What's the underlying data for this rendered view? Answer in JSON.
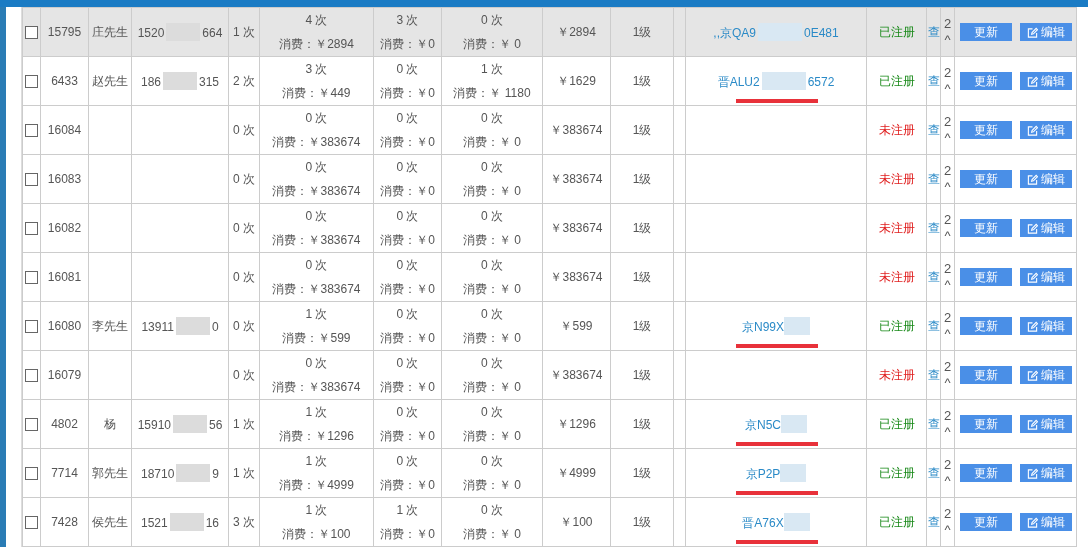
{
  "rows": [
    {
      "highlighted": true,
      "checked": false,
      "id": "15795",
      "name": "庄先生",
      "phone": [
        "1520",
        "664"
      ],
      "visits": "1 次",
      "usage": [
        [
          "4 次",
          "消费：￥2894"
        ],
        [
          "3 次",
          "消费：￥0"
        ],
        [
          "0 次",
          "消费：￥ 0"
        ]
      ],
      "total": "￥2894",
      "level": "1级",
      "plate": [
        ",,京QA9",
        "0E481"
      ],
      "underlined": false,
      "registered": true,
      "status": "已注册",
      "view": "查",
      "column_15": [
        "2",
        "^"
      ],
      "buttons": [
        "更新",
        "编辑"
      ]
    },
    {
      "highlighted": false,
      "checked": false,
      "id": "6433",
      "name": "赵先生",
      "phone": [
        "186",
        "315"
      ],
      "visits": "2 次",
      "usage": [
        [
          "3 次",
          "消费：￥449"
        ],
        [
          "0 次",
          "消费：￥0"
        ],
        [
          "1 次",
          "消费：￥ 1180"
        ]
      ],
      "total": "￥1629",
      "level": "1级",
      "plate": [
        "晋ALU2",
        "6572"
      ],
      "underlined": true,
      "registered": true,
      "status": "已注册",
      "view": "查",
      "column_15": [
        "2",
        "^"
      ],
      "buttons": [
        "更新",
        "编辑"
      ]
    },
    {
      "highlighted": false,
      "checked": false,
      "id": "16084",
      "visits": "0 次",
      "usage": [
        [
          "0 次",
          "消费：￥383674"
        ],
        [
          "0 次",
          "消费：￥0"
        ],
        [
          "0 次",
          "消费：￥ 0"
        ]
      ],
      "total": "￥383674",
      "level": "1级",
      "underlined": false,
      "registered": false,
      "status": "未注册",
      "view": "查",
      "column_15": [
        "2",
        "^"
      ],
      "buttons": [
        "更新",
        "编辑"
      ]
    },
    {
      "highlighted": false,
      "checked": false,
      "id": "16083",
      "visits": "0 次",
      "usage": [
        [
          "0 次",
          "消费：￥383674"
        ],
        [
          "0 次",
          "消费：￥0"
        ],
        [
          "0 次",
          "消费：￥ 0"
        ]
      ],
      "total": "￥383674",
      "level": "1级",
      "underlined": false,
      "registered": false,
      "status": "未注册",
      "view": "查",
      "column_15": [
        "2",
        "^"
      ],
      "buttons": [
        "更新",
        "编辑"
      ]
    },
    {
      "highlighted": false,
      "checked": false,
      "id": "16082",
      "visits": "0 次",
      "usage": [
        [
          "0 次",
          "消费：￥383674"
        ],
        [
          "0 次",
          "消费：￥0"
        ],
        [
          "0 次",
          "消费：￥ 0"
        ]
      ],
      "total": "￥383674",
      "level": "1级",
      "underlined": false,
      "registered": false,
      "status": "未注册",
      "view": "查",
      "column_15": [
        "2",
        "^"
      ],
      "buttons": [
        "更新",
        "编辑"
      ]
    },
    {
      "highlighted": false,
      "checked": false,
      "id": "16081",
      "visits": "0 次",
      "usage": [
        [
          "0 次",
          "消费：￥383674"
        ],
        [
          "0 次",
          "消费：￥0"
        ],
        [
          "0 次",
          "消费：￥ 0"
        ]
      ],
      "total": "￥383674",
      "level": "1级",
      "underlined": false,
      "registered": false,
      "status": "未注册",
      "view": "查",
      "column_15": [
        "2",
        "^"
      ],
      "buttons": [
        "更新",
        "编辑"
      ]
    },
    {
      "highlighted": false,
      "checked": false,
      "id": "16080",
      "name": "李先生",
      "phone": [
        "13911",
        "0"
      ],
      "visits": "0 次",
      "usage": [
        [
          "1 次",
          "消费：￥599"
        ],
        [
          "0 次",
          "消费：￥0"
        ],
        [
          "0 次",
          "消费：￥ 0"
        ]
      ],
      "total": "￥599",
      "level": "1级",
      "plate": [
        "京N99X"
      ],
      "underlined": true,
      "registered": true,
      "status": "已注册",
      "view": "查",
      "column_15": [
        "2",
        "^"
      ],
      "buttons": [
        "更新",
        "编辑"
      ]
    },
    {
      "highlighted": false,
      "checked": false,
      "id": "16079",
      "visits": "0 次",
      "usage": [
        [
          "0 次",
          "消费：￥383674"
        ],
        [
          "0 次",
          "消费：￥0"
        ],
        [
          "0 次",
          "消费：￥ 0"
        ]
      ],
      "total": "￥383674",
      "level": "1级",
      "underlined": false,
      "registered": false,
      "status": "未注册",
      "view": "查",
      "column_15": [
        "2",
        "^"
      ],
      "buttons": [
        "更新",
        "编辑"
      ]
    },
    {
      "highlighted": false,
      "checked": false,
      "id": "4802",
      "name": "杨",
      "phone": [
        "15910",
        "56"
      ],
      "visits": "1 次",
      "usage": [
        [
          "1 次",
          "消费：￥1296"
        ],
        [
          "0 次",
          "消费：￥0"
        ],
        [
          "0 次",
          "消费：￥ 0"
        ]
      ],
      "total": "￥1296",
      "level": "1级",
      "plate": [
        "京N5C"
      ],
      "underlined": true,
      "registered": true,
      "status": "已注册",
      "view": "查",
      "column_15": [
        "2",
        "^"
      ],
      "buttons": [
        "更新",
        "编辑"
      ]
    },
    {
      "highlighted": false,
      "checked": false,
      "id": "7714",
      "name": "郭先生",
      "phone": [
        "18710",
        "9"
      ],
      "visits": "1 次",
      "usage": [
        [
          "1 次",
          "消费：￥4999"
        ],
        [
          "0 次",
          "消费：￥0"
        ],
        [
          "0 次",
          "消费：￥ 0"
        ]
      ],
      "total": "￥4999",
      "level": "1级",
      "plate": [
        "京P2P"
      ],
      "underlined": true,
      "registered": true,
      "status": "已注册",
      "view": "查",
      "column_15": [
        "2",
        "^"
      ],
      "buttons": [
        "更新",
        "编辑"
      ]
    },
    {
      "highlighted": false,
      "checked": false,
      "id": "7428",
      "name": "侯先生",
      "phone": [
        "1521",
        "16"
      ],
      "visits": "3 次",
      "usage": [
        [
          "1 次",
          "消费：￥100"
        ],
        [
          "1 次",
          "消费：￥0"
        ],
        [
          "0 次",
          "消费：￥ 0"
        ]
      ],
      "total": "￥100",
      "level": "1级",
      "plate": [
        "晋A76X"
      ],
      "underlined": true,
      "registered": true,
      "status": "已注册",
      "view": "查",
      "column_15": [
        "2",
        "^"
      ],
      "buttons": [
        "更新",
        "编辑"
      ]
    }
  ]
}
